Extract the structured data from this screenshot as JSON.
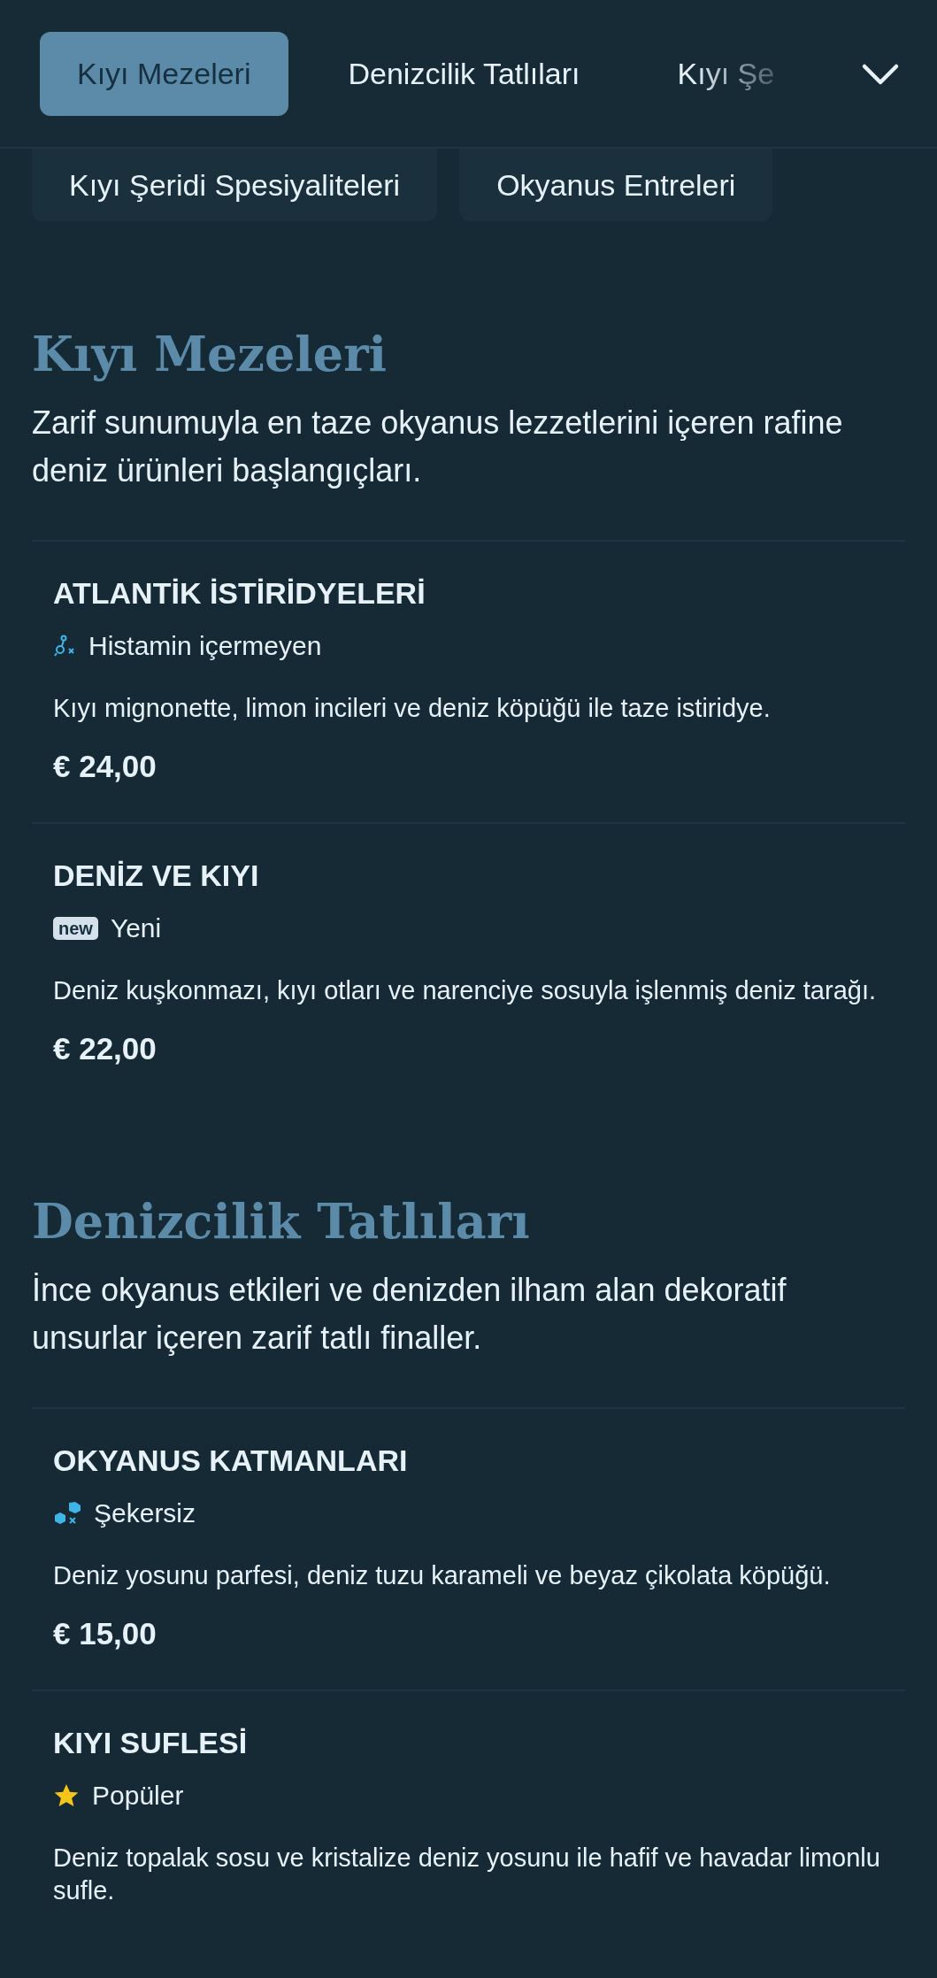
{
  "tabs": [
    {
      "label": "Kıyı Mezeleri",
      "selected": true
    },
    {
      "label": "Denizcilik Tatlıları",
      "selected": false
    },
    {
      "label": "Kıyı Şe",
      "selected": false
    }
  ],
  "category_menu": {
    "expanded": true,
    "items": [
      "Kıyı Şeridi Spesiyaliteleri",
      "Okyanus Entreleri"
    ]
  },
  "sections": [
    {
      "title": "Kıyı Mezeleri",
      "description": "Zarif sunumuyla en taze okyanus lezzetlerini içeren rafine deniz ürünleri başlangıçları.",
      "items": [
        {
          "name": "ATLANTİK İSTİRİDYELERİ",
          "tag": {
            "kind": "histamine-free",
            "label": "Histamin içermeyen"
          },
          "description": "Kıyı mignonette, limon incileri ve deniz köpüğü ile taze istiridye.",
          "price": "€ 24,00"
        },
        {
          "name": "DENİZ VE KIYI",
          "tag": {
            "kind": "new",
            "badge": "new",
            "label": "Yeni"
          },
          "description": "Deniz kuşkonmazı, kıyı otları ve narenciye sosuyla işlenmiş deniz tarağı.",
          "price": "€ 22,00"
        }
      ]
    },
    {
      "title": "Denizcilik Tatlıları",
      "description": "İnce okyanus etkileri ve denizden ilham alan dekoratif unsurlar içeren zarif tatlı finaller.",
      "items": [
        {
          "name": "OKYANUS KATMANLARI",
          "tag": {
            "kind": "sugar-free",
            "label": "Şekersiz"
          },
          "description": "Deniz yosunu parfesi, deniz tuzu karameli ve beyaz çikolata köpüğü.",
          "price": "€ 15,00"
        },
        {
          "name": "KIYI SUFLESİ",
          "tag": {
            "kind": "popular",
            "label": "Popüler"
          },
          "description": "Deniz topalak sosu ve kristalize deniz yosunu ile hafif ve havadar limonlu sufle."
        }
      ]
    }
  ]
}
